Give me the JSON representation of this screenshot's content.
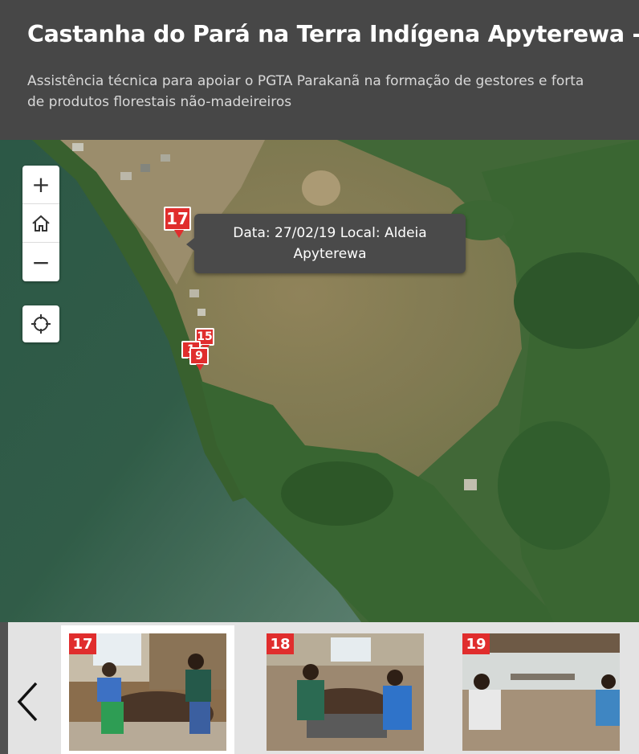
{
  "header": {
    "title": "Castanha do Pará na Terra Indígena Apyterewa - Sa",
    "subtitle_line1": "Assistência técnica para apoiar o PGTA Parakanã na formação de gestores e forta",
    "subtitle_line2": "de produtos florestais não-madeireiros"
  },
  "map_controls": {
    "zoom_in": "+",
    "home_icon": "home-icon",
    "zoom_out": "−",
    "locate_icon": "crosshair-icon"
  },
  "markers": {
    "m17": "17",
    "m15": "15",
    "m16": "1",
    "m19": "9"
  },
  "tooltip": {
    "text": "Data: 27/02/19 Local: Aldeia Apyterewa"
  },
  "carousel": {
    "prev_icon": "chevron-left-icon",
    "items": [
      {
        "num": "17"
      },
      {
        "num": "18"
      },
      {
        "num": "19"
      }
    ]
  },
  "colors": {
    "marker_red": "#e02d2d",
    "header_bg": "#474747",
    "water": "#2f5a48",
    "forest": "#3f6a34",
    "clearing": "#8a7e56"
  }
}
